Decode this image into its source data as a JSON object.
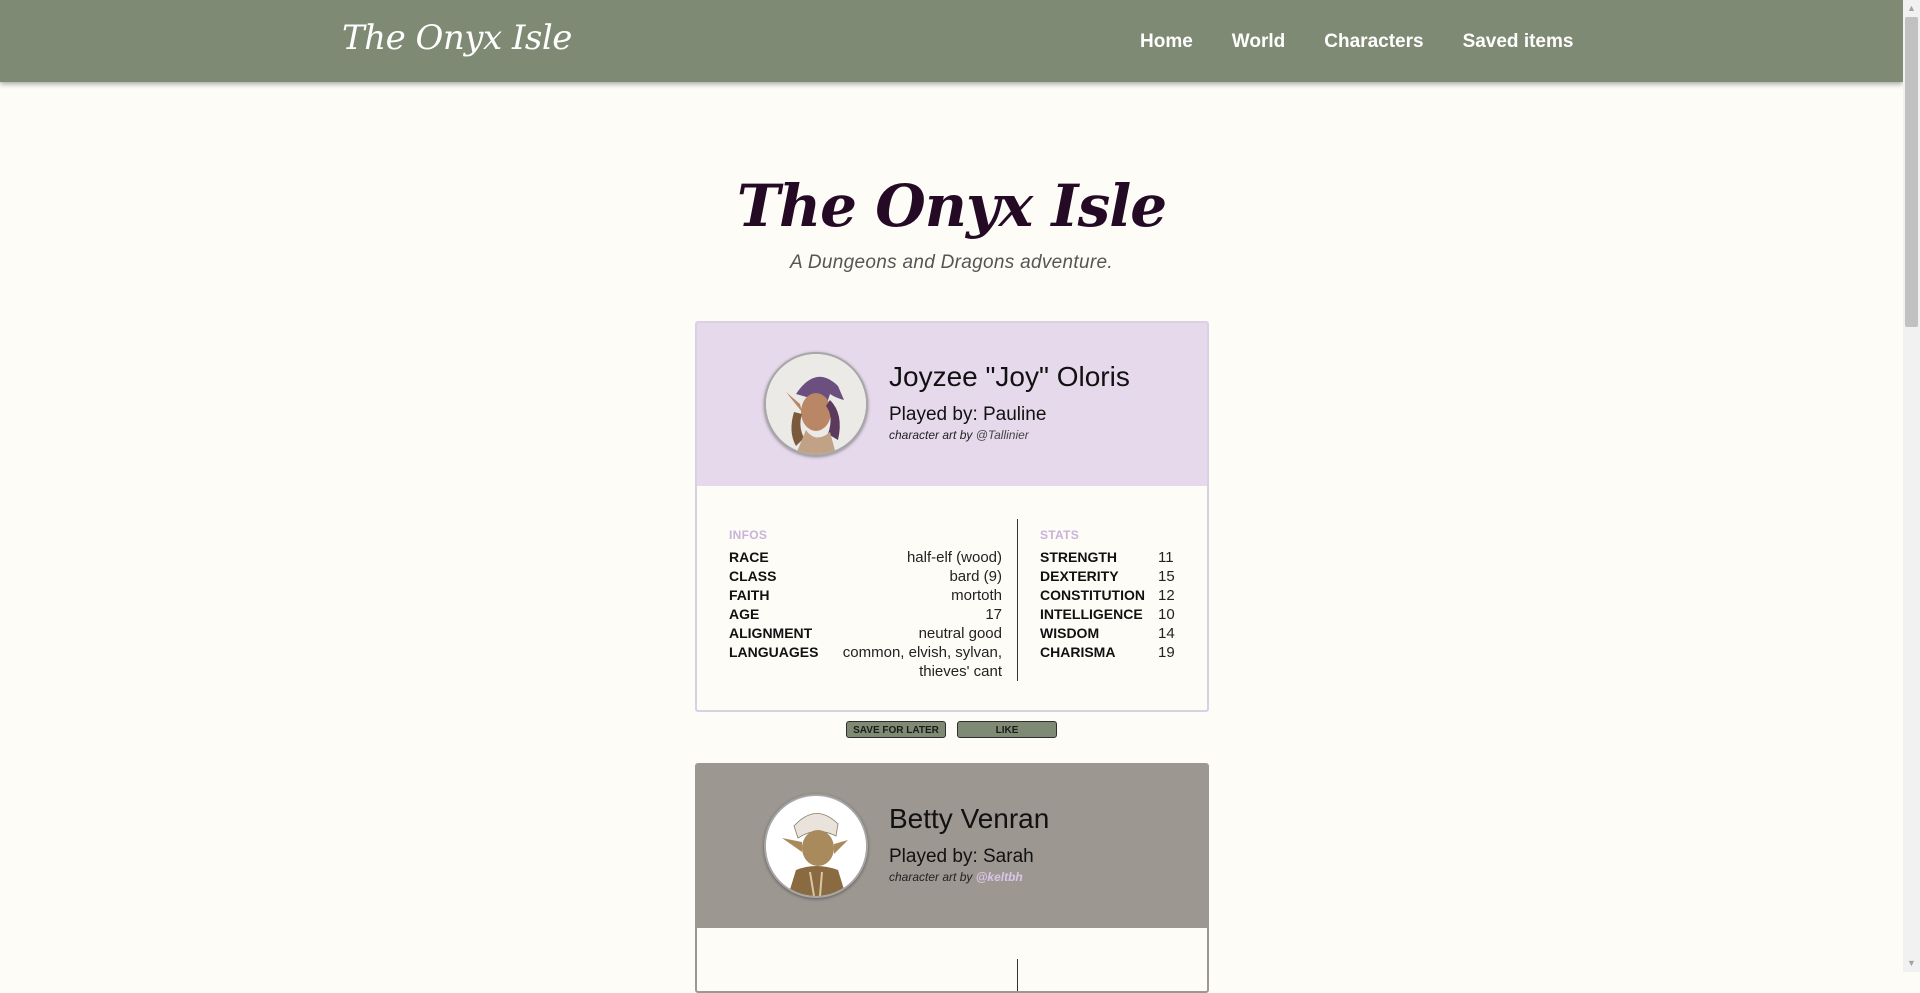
{
  "navbar": {
    "brand": "The Onyx Isle",
    "links": [
      "Home",
      "World",
      "Characters",
      "Saved items"
    ]
  },
  "hero": {
    "title": "The Onyx Isle",
    "subtitle": "A Dungeons and Dragons adventure."
  },
  "characters": [
    {
      "name": "Joyzee \"Joy\" Oloris",
      "played_by": "Played by: Pauline",
      "credit_prefix": "character art by ",
      "credit_handle": "@Tallinier",
      "header_color": "#e6d9eb",
      "infos_label": "INFOS",
      "stats_label": "STATS",
      "infos": [
        {
          "key": "RACE",
          "value": "half-elf (wood)"
        },
        {
          "key": "CLASS",
          "value": "bard (9)"
        },
        {
          "key": "FAITH",
          "value": "mortoth"
        },
        {
          "key": "AGE",
          "value": "17"
        },
        {
          "key": "ALIGNMENT",
          "value": "neutral good"
        },
        {
          "key": "LANGUAGES",
          "value": "common, elvish, sylvan, thieves' cant"
        }
      ],
      "stats": [
        {
          "key": "STRENGTH",
          "value": "11"
        },
        {
          "key": "DEXTERITY",
          "value": "15"
        },
        {
          "key": "CONSTITUTION",
          "value": "12"
        },
        {
          "key": "INTELLIGENCE",
          "value": "10"
        },
        {
          "key": "WISDOM",
          "value": "14"
        },
        {
          "key": "CHARISMA",
          "value": "19"
        }
      ],
      "buttons": {
        "save": "SAVE FOR LATER",
        "like": "LIKE"
      }
    },
    {
      "name": "Betty Venran",
      "played_by": "Played by: Sarah",
      "credit_prefix": "character art by ",
      "credit_handle": "@keltbh",
      "header_color": "#9d9791"
    }
  ],
  "colors": {
    "navbar": "#7e8a73",
    "page_background": "#fdfcf7",
    "hero_title": "#250a26",
    "section_label": "#c8b3d9"
  },
  "icons": [
    "joy-portrait",
    "betty-portrait",
    "scroll-up-arrow",
    "scroll-down-arrow"
  ]
}
